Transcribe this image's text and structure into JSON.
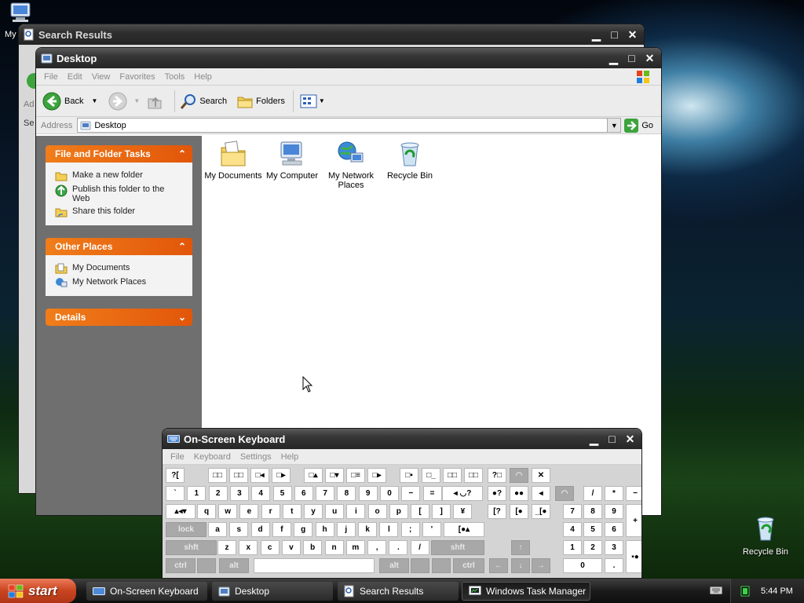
{
  "desktop": {
    "icons": [
      {
        "label": "My",
        "icon": "my-computer-icon"
      },
      {
        "label": "Recycle Bin",
        "icon": "recycle-bin-icon"
      }
    ]
  },
  "search_window": {
    "title": "Search Results",
    "partial_texts": [
      "Ad",
      "Se"
    ]
  },
  "explorer": {
    "title": "Desktop",
    "menu": [
      "File",
      "Edit",
      "View",
      "Favorites",
      "Tools",
      "Help"
    ],
    "toolbar": {
      "back": "Back",
      "search": "Search",
      "folders": "Folders"
    },
    "address": {
      "label": "Address",
      "value": "Desktop",
      "go": "Go"
    },
    "tasks": {
      "title": "File and Folder Tasks",
      "items": [
        "Make a new folder",
        "Publish this folder to the Web",
        "Share this folder"
      ]
    },
    "other_places": {
      "title": "Other Places",
      "items": [
        "My Documents",
        "My Network Places"
      ]
    },
    "details": {
      "title": "Details"
    },
    "files": [
      {
        "label": "My Documents",
        "icon": "my-documents-icon"
      },
      {
        "label": "My Computer",
        "icon": "my-computer-icon"
      },
      {
        "label": "My Network Places",
        "icon": "network-places-icon"
      },
      {
        "label": "Recycle Bin",
        "icon": "recycle-bin-icon"
      }
    ]
  },
  "osk": {
    "title": "On-Screen Keyboard",
    "menu": [
      "File",
      "Keyboard",
      "Settings",
      "Help"
    ],
    "keys": {
      "row0": [
        "?[",
        "□□",
        "□□",
        "□◂",
        "□▸",
        "□▴",
        "□▾",
        "□≡",
        "□▸",
        "□▪",
        "□_",
        "□□",
        "□□",
        "?□",
        "◠",
        "✕"
      ],
      "row1": [
        "`",
        "1",
        "2",
        "3",
        "4",
        "5",
        "6",
        "7",
        "8",
        "9",
        "0",
        "−",
        "=",
        "◂ ◡?",
        "●?",
        "●●",
        "◂",
        "◠",
        "/",
        "*",
        "−"
      ],
      "row2": [
        "▴◂▾",
        "q",
        "w",
        "e",
        "r",
        "t",
        "y",
        "u",
        "i",
        "o",
        "p",
        "[",
        "]",
        "¥",
        "[?",
        "[●",
        "_[●",
        "7",
        "8",
        "9",
        "+"
      ],
      "row3": [
        "lock",
        "a",
        "s",
        "d",
        "f",
        "g",
        "h",
        "j",
        "k",
        "l",
        ";",
        "'",
        "[●▴",
        "4",
        "5",
        "6"
      ],
      "row4": [
        "shft",
        "z",
        "x",
        "c",
        "v",
        "b",
        "n",
        "m",
        ",",
        ".",
        "/",
        "shft",
        "↑",
        "1",
        "2",
        "3",
        "▪●"
      ],
      "row5": [
        "ctrl",
        "alt",
        "alt",
        "ctrl",
        "←",
        "↓",
        "→",
        "0",
        "."
      ]
    }
  },
  "taskbar": {
    "start": "start",
    "tasks": [
      "On-Screen Keyboard",
      "Desktop",
      "Search Results",
      "Windows Task Manager"
    ],
    "clock": "5:44 PM"
  }
}
